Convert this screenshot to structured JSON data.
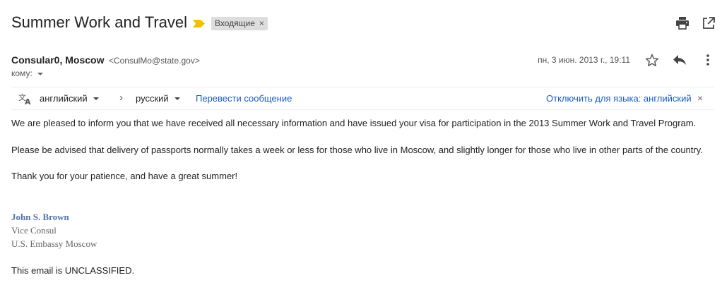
{
  "header": {
    "subject": "Summer Work and Travel",
    "label_chip": "Входящие",
    "chip_close": "×"
  },
  "sender": {
    "name": "Consular0, Moscow",
    "email": "<ConsulMo@state.gov>",
    "to_label": "кому:",
    "date": "пн, 3 июн. 2013 г., 19:11"
  },
  "translation_bar": {
    "source_lang": "английский",
    "target_lang": "русский",
    "translate_link": "Перевести сообщение",
    "disable_link": "Отключить для языка: английский",
    "close": "×"
  },
  "body": {
    "p1": "We are pleased to inform you that we have received all necessary information and have issued your visa for participation in the 2013 Summer Work and Travel Program.",
    "p2": "Please be advised that delivery of passports normally takes a week or less for those who live in Moscow, and slightly longer for those who live in other parts of the country.",
    "p3": "Thank you for your patience, and have a great summer!",
    "signature_name": "John S. Brown",
    "signature_title": "Vice Consul",
    "signature_org": "U.S. Embassy Moscow",
    "footer": "This email is UNCLASSIFIED."
  },
  "icons": {
    "print": "print-icon",
    "open_new_window": "open-in-new-window-icon",
    "star": "star-icon",
    "reply": "reply-icon",
    "more": "more-vert-icon",
    "translate": "translate-icon",
    "importance_marker": "importance-marker-icon"
  },
  "colors": {
    "importance_marker": "#f2c200",
    "link_blue": "#1a5bbf",
    "signature_blue": "#5572a8",
    "chip_bg": "#dddddd"
  }
}
